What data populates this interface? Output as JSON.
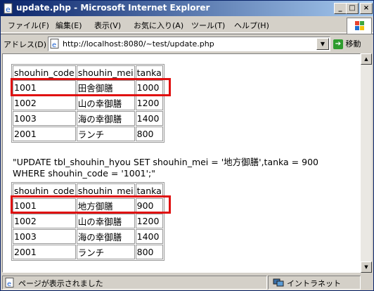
{
  "window": {
    "title": "update.php - Microsoft Internet Explorer"
  },
  "titlebar_buttons": {
    "minimize": "_",
    "maximize": "□",
    "close": "×"
  },
  "menu": [
    "ファイル(F)",
    "編集(E)",
    "表示(V)",
    "お気に入り(A)",
    "ツール(T)",
    "ヘルプ(H)"
  ],
  "address": {
    "label": "アドレス(D)",
    "url": "http://localhost:8080/~test/update.php",
    "go_label": "移動"
  },
  "table_before": {
    "headers": [
      "shouhin_code",
      "shouhin_mei",
      "tanka"
    ],
    "rows": [
      [
        "1001",
        "田舎御膳",
        "1000"
      ],
      [
        "1002",
        "山の幸御膳",
        "1200"
      ],
      [
        "1003",
        "海の幸御膳",
        "1400"
      ],
      [
        "2001",
        "ランチ",
        "800"
      ]
    ]
  },
  "sql": "\"UPDATE tbl_shouhin_hyou SET shouhin_mei = '地方御膳',tanka = 900 WHERE shouhin_code = '1001';\"",
  "table_after": {
    "headers": [
      "shouhin_code",
      "shouhin_mei",
      "tanka"
    ],
    "rows": [
      [
        "1001",
        "地方御膳",
        "900"
      ],
      [
        "1002",
        "山の幸御膳",
        "1200"
      ],
      [
        "1003",
        "海の幸御膳",
        "1400"
      ],
      [
        "2001",
        "ランチ",
        "800"
      ]
    ]
  },
  "highlight_color": "#e01010",
  "status": {
    "text": "ページが表示されました",
    "zone": "イントラネット"
  }
}
